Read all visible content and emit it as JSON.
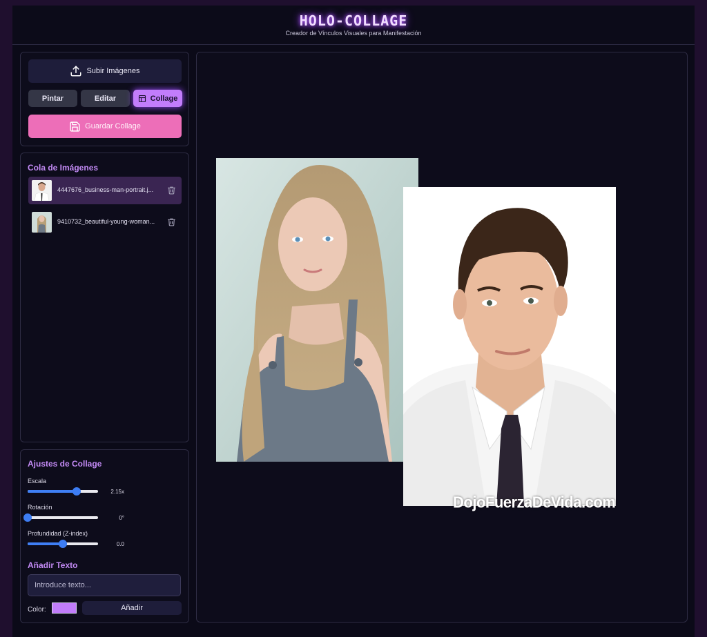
{
  "header": {
    "title": "HOLO-COLLAGE",
    "subtitle": "Creador de Vínculos Visuales para Manifestación"
  },
  "toolbar": {
    "upload_label": "Subir Imágenes",
    "modes": [
      {
        "label": "Pintar",
        "icon": "",
        "active": false
      },
      {
        "label": "Editar",
        "icon": "",
        "active": false
      },
      {
        "label": "Collage",
        "icon": "layout-icon",
        "active": true
      }
    ],
    "save_label": "Guardar Collage"
  },
  "queue": {
    "title": "Cola de Imágenes",
    "items": [
      {
        "name": "4447676_business-man-portrait.j...",
        "selected": true
      },
      {
        "name": "9410732_beautiful-young-woman...",
        "selected": false
      }
    ]
  },
  "settings": {
    "title": "Ajustes de Collage",
    "scale": {
      "label": "Escala",
      "value": "2.15x",
      "fraction": 0.7
    },
    "rotation": {
      "label": "Rotación",
      "value": "0°",
      "fraction": 0.0
    },
    "depth": {
      "label": "Profundidad (Z-index)",
      "value": "0.0",
      "fraction": 0.5
    },
    "add_text": {
      "title": "Añadir Texto",
      "placeholder": "Introduce texto...",
      "color_label": "Color:",
      "color": "#c27dfb",
      "button_label": "Añadir"
    }
  },
  "canvas": {
    "watermark": "DojoFuerzaDeVida.com"
  },
  "colors": {
    "accent": "#c27dfb",
    "save": "#ed6eb8",
    "slider": "#3f7ff5"
  }
}
